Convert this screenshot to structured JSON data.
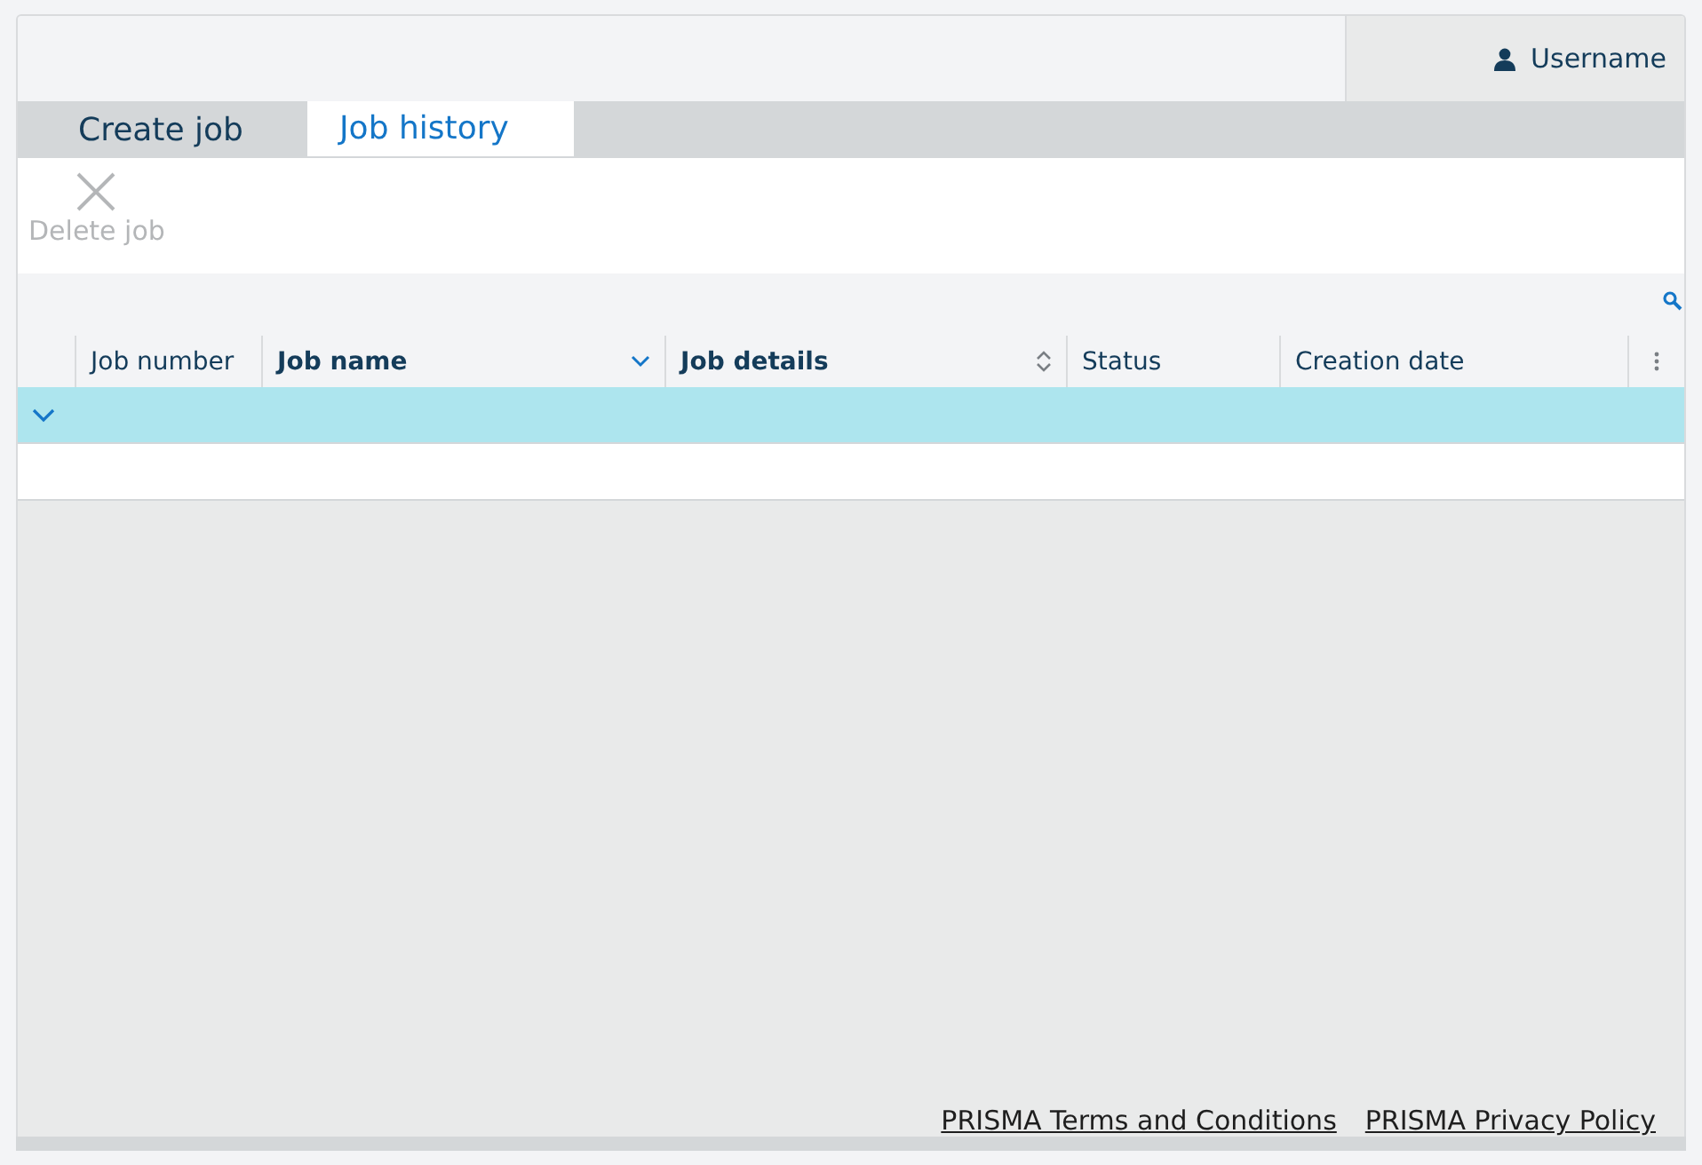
{
  "user": {
    "name": "Username"
  },
  "tabs": [
    {
      "label": "Create job",
      "selected": false
    },
    {
      "label": "Job history",
      "selected": true
    }
  ],
  "toolbar": {
    "delete": {
      "label": "Delete job",
      "disabled": true
    }
  },
  "table": {
    "columns": [
      {
        "label": "Job number",
        "sortable": false,
        "sorted": false
      },
      {
        "label": "Job name",
        "sortable": true,
        "sorted": true
      },
      {
        "label": "Job details",
        "sortable": true,
        "sorted": false
      },
      {
        "label": "Status",
        "sortable": false,
        "sorted": false
      },
      {
        "label": "Creation date",
        "sortable": false,
        "sorted": false
      }
    ],
    "rows": [
      {
        "selected": true,
        "expanded": true
      },
      {
        "selected": false,
        "expanded": false
      }
    ]
  },
  "footer": {
    "links": [
      "PRISMA Terms and Conditions",
      "PRISMA Privacy Policy"
    ]
  }
}
